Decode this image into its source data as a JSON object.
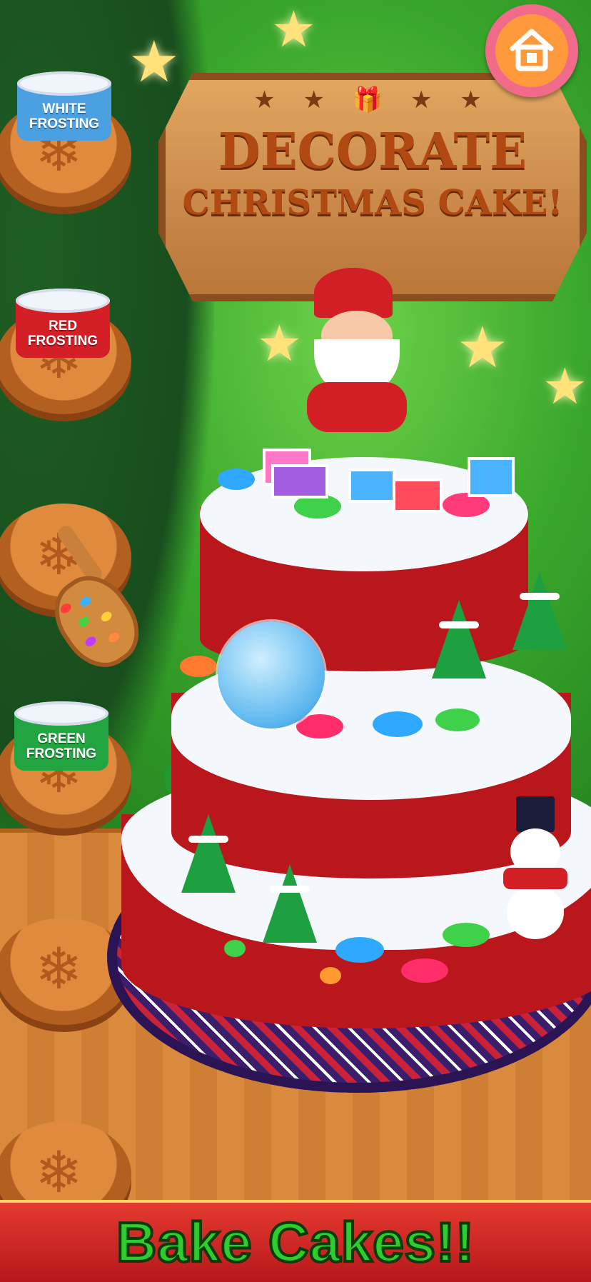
{
  "title_sign": {
    "line1": "DECORATE",
    "line2": "CHRISTMAS CAKE!"
  },
  "home_button": {
    "icon": "home-icon"
  },
  "frosting_tubs": [
    {
      "label": "WHITE FROSTING",
      "color": "#4aa0e0"
    },
    {
      "label": "RED FROSTING",
      "color": "#d41f27"
    },
    {
      "label": "GREEN FROSTING",
      "color": "#22a540"
    }
  ],
  "shelf_icon": "snowflake-icon",
  "sprinkle_scoop": {
    "icon": "scoop-icon"
  },
  "banner": {
    "text": "Bake Cakes!!"
  },
  "colors": {
    "background_green": "#3aa82c",
    "cake_red": "#b9171c",
    "icing_white": "#f4f7fb",
    "banner_red": "#d0221e",
    "banner_text_green": "#2ecc2e"
  }
}
